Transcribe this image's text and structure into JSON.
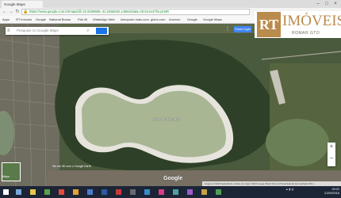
{
  "browser": {
    "tab_title": "Google Maps",
    "url": "https://www.google.com.br/maps/@-22.9238606,-42.2456262,1455m/data=!3m1!1e3?hl=pt-BR",
    "bookmarks": [
      "Apps",
      "RT Imóveis",
      "Google",
      "National Bonus",
      "Flat 40",
      "WhatsApp Web",
      "Aeroporto mais.com",
      "globo.com",
      "Anúncio",
      "Google",
      "Google Maps"
    ]
  },
  "map": {
    "search_placeholder": "Pesquise no Google Maps",
    "place_label": "Brejo do Espinho",
    "earth_note": "Ver em 3D com o Google Earth",
    "satellite_label": "Mapa",
    "watermark": "Google",
    "footer": "Imagens ©2016 DigitalGlobe, Dados do mapa ©2016 Google  Brasil  Termos  Privacidade  Enviar feedback  200 m",
    "sign_in": "Fazer login"
  },
  "logo": {
    "mark": "RT",
    "brand": "IMÓVEIS",
    "sub": "ROMAR GTO"
  },
  "taskbar": {
    "time": "09:22",
    "date": "21/09/2016"
  },
  "colors": {
    "lagoon": "#b8c4a8",
    "vegetation": "#3e5234",
    "brand": "#b98b4d",
    "taskbar": "#1c2536"
  }
}
